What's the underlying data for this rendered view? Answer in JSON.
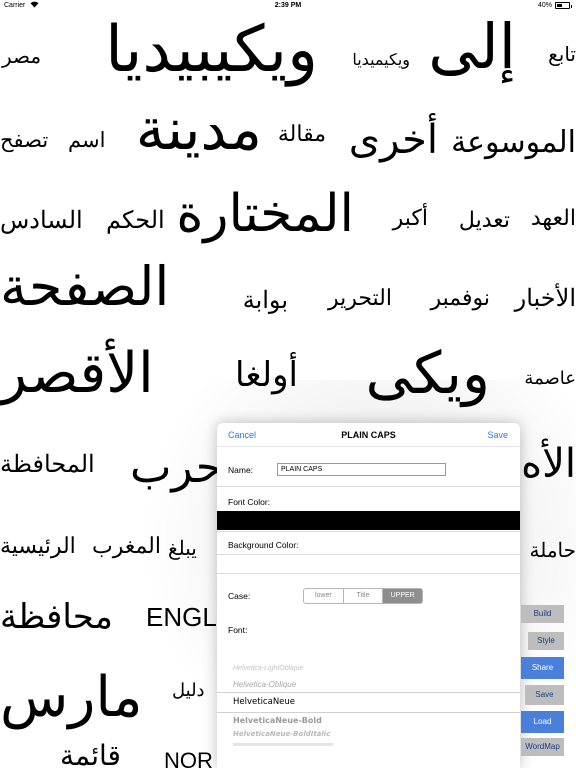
{
  "status_bar": {
    "carrier": "Carrier",
    "time": "2:39 PM",
    "battery_pct": "40%",
    "battery_level": 0.4
  },
  "background_words": [
    {
      "text": "تابع"
    },
    {
      "text": "إلى"
    },
    {
      "text": "ويكيميديا"
    },
    {
      "text": "ويكيبيديا"
    },
    {
      "text": "مصر"
    },
    {
      "text": "الموسوعة"
    },
    {
      "text": "أخرى"
    },
    {
      "text": "مقالة"
    },
    {
      "text": "مدينة"
    },
    {
      "text": "اسم"
    },
    {
      "text": "تصفح"
    },
    {
      "text": "العهد"
    },
    {
      "text": "تعديل"
    },
    {
      "text": "أكبر"
    },
    {
      "text": "المختارة"
    },
    {
      "text": "الحكم"
    },
    {
      "text": "السادس"
    },
    {
      "text": "الأخبار"
    },
    {
      "text": "نوفمبر"
    },
    {
      "text": "التحرير"
    },
    {
      "text": "بوابة"
    },
    {
      "text": "الصفحة"
    },
    {
      "text": "عاصمة"
    },
    {
      "text": "ويكى"
    },
    {
      "text": "أولغا"
    },
    {
      "text": "الأقصر"
    },
    {
      "text": "الأه"
    },
    {
      "text": "حرب"
    },
    {
      "text": "المحافظة"
    },
    {
      "text": "حاملة"
    },
    {
      "text": "يبلغ"
    },
    {
      "text": "المغرب"
    },
    {
      "text": "الرئيسية"
    },
    {
      "text": "محافظة"
    },
    {
      "text": "ENGL"
    },
    {
      "text": "مارس"
    },
    {
      "text": "دليل"
    },
    {
      "text": "NOR"
    },
    {
      "text": "قائمة"
    }
  ],
  "panel": {
    "cancel_label": "Cancel",
    "title": "PLAIN CAPS",
    "save_label": "Save",
    "name_label": "Name:",
    "name_value": "PLAIN CAPS",
    "font_color_label": "Font Color:",
    "font_color": "#000000",
    "background_color_label": "Background Color:",
    "background_color": "#ffffff",
    "case_label": "Case:",
    "case_options": [
      "lower",
      "Title",
      "UPPER"
    ],
    "case_selected": "UPPER",
    "font_label": "Font:",
    "font_options": [
      "Helvetica-LightOblique",
      "Helvetica-Oblique",
      "HelveticaNeue",
      "HelveticaNeue-Bold",
      "HelveticaNeue-BoldItalic"
    ],
    "font_selected": "HelveticaNeue"
  },
  "side_buttons": {
    "build": "Build",
    "style": "Style",
    "share": "Share",
    "save": "Save",
    "load": "Load",
    "wordmap": "WordMap"
  },
  "colors": {
    "accent_blue": "#2a7ae2",
    "button_blue": "#4a7fdb",
    "button_gray": "#bdbdbd",
    "segment_active": "#8e8e8e"
  }
}
